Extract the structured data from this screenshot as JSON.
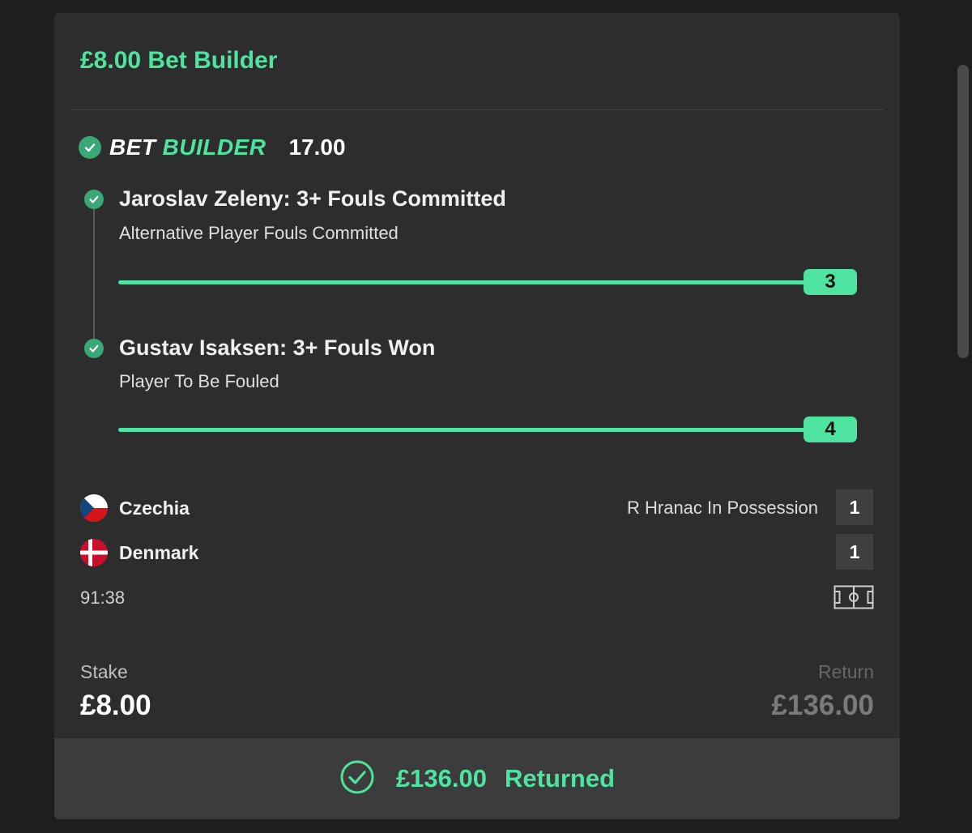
{
  "bet": {
    "title": "£8.00 Bet Builder",
    "builder_word_1": "BET",
    "builder_word_2": "BUILDER",
    "odds": "17.00"
  },
  "selections": [
    {
      "title": "Jaroslav Zeleny: 3+ Fouls Committed",
      "market": "Alternative Player Fouls Committed",
      "value": "3"
    },
    {
      "title": "Gustav Isaksen: 3+ Fouls Won",
      "market": "Player To Be Fouled",
      "value": "4"
    }
  ],
  "match": {
    "home": {
      "name": "Czechia",
      "score": "1"
    },
    "away": {
      "name": "Denmark",
      "score": "1"
    },
    "status": "R Hranac In Possession",
    "clock": "91:38"
  },
  "stake": {
    "label": "Stake",
    "value": "£8.00"
  },
  "return": {
    "label": "Return",
    "value": "£136.00"
  },
  "result": {
    "amount": "£136.00",
    "label": "Returned"
  },
  "colors": {
    "accent": "#4fe3a1",
    "check": "#39a777",
    "card": "#2d2d2d",
    "background": "#1e1e1e"
  },
  "icons": [
    "check-circle-icon",
    "pitch-icon",
    "czech-flag-icon",
    "denmark-flag-icon",
    "returned-check-icon"
  ]
}
